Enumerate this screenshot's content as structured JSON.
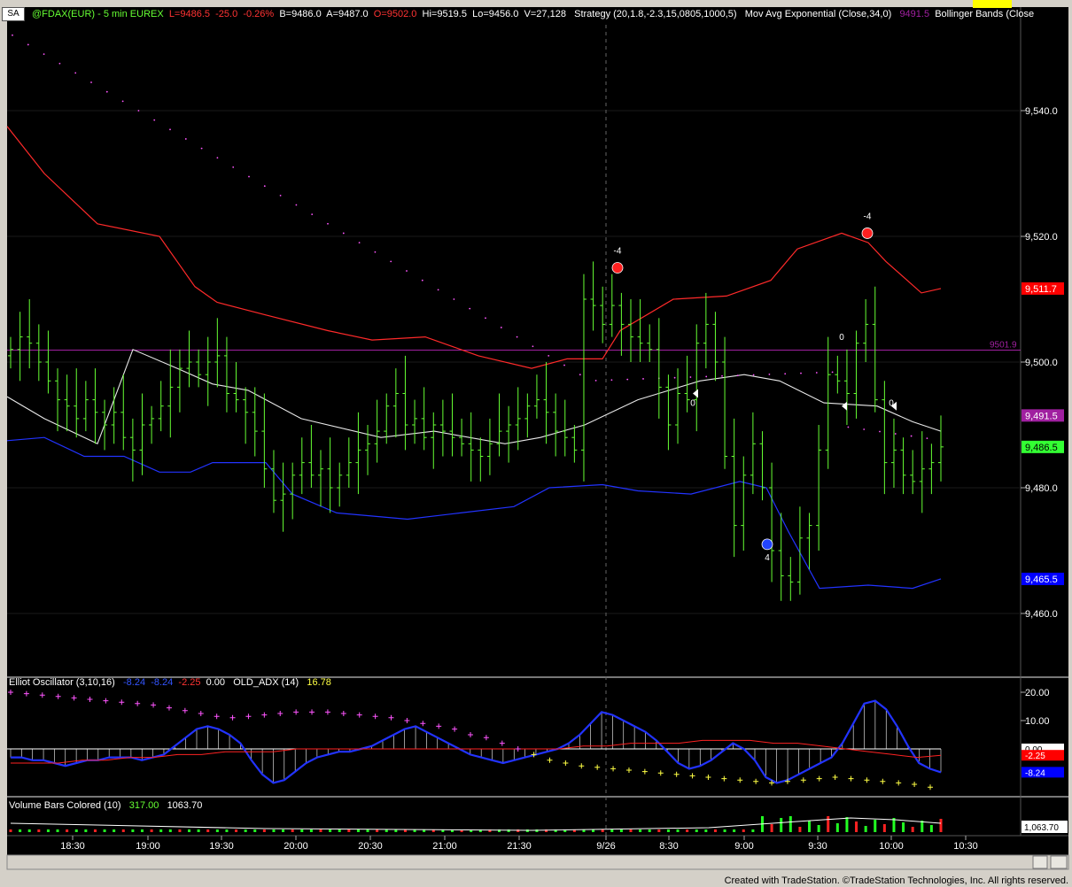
{
  "header": {
    "tab": "SA",
    "symbol": "@FDAX(EUR) - 5 min  EUREX",
    "last": "L=9486.5",
    "change": "-25.0",
    "pct": "-0.26%",
    "bid": "B=9486.0",
    "ask": "A=9487.0",
    "open": "O=9502.0",
    "hi": "Hi=9519.5",
    "lo": "Lo=9456.0",
    "vol": "V=27,128",
    "strategy": "Strategy (20,1.8,-2.3,15,0805,1000,5)",
    "ema": "Mov Avg Exponential (Close,34,0)",
    "ema_val": "9491.5",
    "bb": "Bollinger Bands (Close"
  },
  "oscillator": {
    "title": "Elliot Oscillator (3,10,16)",
    "v1": "-8.24",
    "v2": "-8.24",
    "v3": "-2.25",
    "v4": "0.00",
    "adx_title": "OLD_ADX (14)",
    "adx_val": "16.78"
  },
  "volume": {
    "title": "Volume Bars Colored (10)",
    "v1": "317.00",
    "v2": "1063.70"
  },
  "colors": {
    "background": "#000000",
    "bar_up": "#66ff33",
    "upper_band": "#ff2a2a",
    "lower_band": "#2233ff",
    "ema": "#e8e8e8",
    "hline": "#a020a0",
    "sar": "#ff55ff",
    "adx": "#ffff44"
  },
  "chart_data": [
    {
      "type": "ohlc",
      "title": "@FDAX(EUR) - 5 min",
      "y_ticks": [
        "9,540.0",
        "9,520.0",
        "9,500.0",
        "9,480.0",
        "9,460.0"
      ],
      "ylim": [
        9450,
        9550
      ],
      "x_ticks": [
        "18:30",
        "19:00",
        "19:30",
        "20:00",
        "20:30",
        "21:00",
        "21:30",
        "9/26",
        "8:30",
        "9:00",
        "9:30",
        "10:00",
        "10:30"
      ],
      "right_labels": {
        "upper_band": "9,511.7",
        "hline": "9501.9",
        "ema": "9,491.5",
        "last": "9,486.5",
        "lower_band": "9,465.5"
      },
      "hline": 9501.9,
      "strategy_labels": [
        "-4",
        "-4",
        "0",
        "0",
        "4",
        "0"
      ],
      "closes": [
        9502,
        9504,
        9503,
        9500,
        9497,
        9494,
        9493,
        9491,
        9494,
        9492,
        9490,
        9492,
        9488,
        9486,
        9490,
        9491,
        9493,
        9496,
        9499,
        9500,
        9498,
        9500,
        9501,
        9495,
        9494,
        9492,
        9489,
        9483,
        9478,
        9479,
        9482,
        9484,
        9482,
        9483,
        9480,
        9482,
        9484,
        9486,
        9487,
        9489,
        9493,
        9495,
        9490,
        9491,
        9488,
        9490,
        9489,
        9488,
        9487,
        9486,
        9485,
        9487,
        9489,
        9490,
        9491,
        9493,
        9494,
        9492,
        9489,
        9488,
        9486,
        9510,
        9509,
        9506,
        9509,
        9506,
        9504,
        9503,
        9502,
        9496,
        9490,
        9495,
        9494,
        9503,
        9506,
        9500,
        9485,
        9474,
        9482,
        9487,
        9480,
        9470,
        9466,
        9465,
        9472,
        9474,
        9486,
        9498,
        9497,
        9495,
        9503,
        9506,
        9494,
        9484,
        9486,
        9482,
        9481,
        9483,
        9484,
        9486.5
      ]
    },
    {
      "type": "oscillator",
      "title": "Elliot Oscillator (3,10,16)",
      "y_ticks": [
        "20.00",
        "10.00"
      ],
      "ylim": [
        -15,
        22
      ],
      "right_labels": {
        "zero": "0.00",
        "red": "-2.25",
        "blue": "-8.24"
      },
      "histogram": [
        -3,
        -3,
        -4,
        -4,
        -5,
        -6,
        -5,
        -4,
        -4,
        -3,
        -3,
        -3,
        -4,
        -3,
        -2,
        1,
        4,
        7,
        8,
        7,
        5,
        2,
        -4,
        -9,
        -12,
        -11,
        -8,
        -5,
        -3,
        -2,
        -1,
        -1,
        0,
        1,
        3,
        5,
        7,
        8,
        6,
        4,
        2,
        0,
        -2,
        -3,
        -4,
        -5,
        -4,
        -3,
        -2,
        -1,
        0,
        2,
        5,
        9,
        13,
        12,
        10,
        8,
        6,
        3,
        -1,
        -5,
        -7,
        -6,
        -4,
        -1,
        2,
        0,
        -4,
        -10,
        -12,
        -11,
        -9,
        -7,
        -5,
        -3,
        2,
        9,
        16,
        17,
        14,
        8,
        1,
        -5,
        -7,
        -8.24
      ],
      "adx": [
        20,
        19.5,
        19,
        18.5,
        18,
        17.5,
        17,
        16.5,
        16,
        15.5,
        14.5,
        13.5,
        12.5,
        11.5,
        11,
        11.5,
        12,
        12.5,
        13,
        13,
        13,
        12.5,
        12,
        11.5,
        11,
        10,
        9,
        8,
        7,
        5,
        4,
        2,
        0,
        -2,
        -4,
        -5,
        -6,
        -6.5,
        -7,
        -7.5,
        -8,
        -8.5,
        -9,
        -9.5,
        -10,
        -10.5,
        -11,
        -11.5,
        -12,
        -11.5,
        -11,
        -10.5,
        -10,
        -10.5,
        -11,
        -11.5,
        -12,
        -12.5,
        -13.5
      ],
      "red_line": [
        -5,
        -5,
        -5,
        -4,
        -4,
        -3,
        -3,
        -2,
        -2,
        -1,
        -1,
        -1,
        0,
        0,
        0,
        0,
        0,
        0,
        0,
        0,
        0,
        0,
        0,
        0,
        1,
        1,
        2,
        2,
        2,
        3,
        3,
        3,
        2,
        2,
        1,
        0,
        -1,
        -2,
        -3,
        -2.25
      ]
    },
    {
      "type": "bar",
      "title": "Volume Bars Colored (10)",
      "right_label": "1,063.70"
    }
  ]
}
